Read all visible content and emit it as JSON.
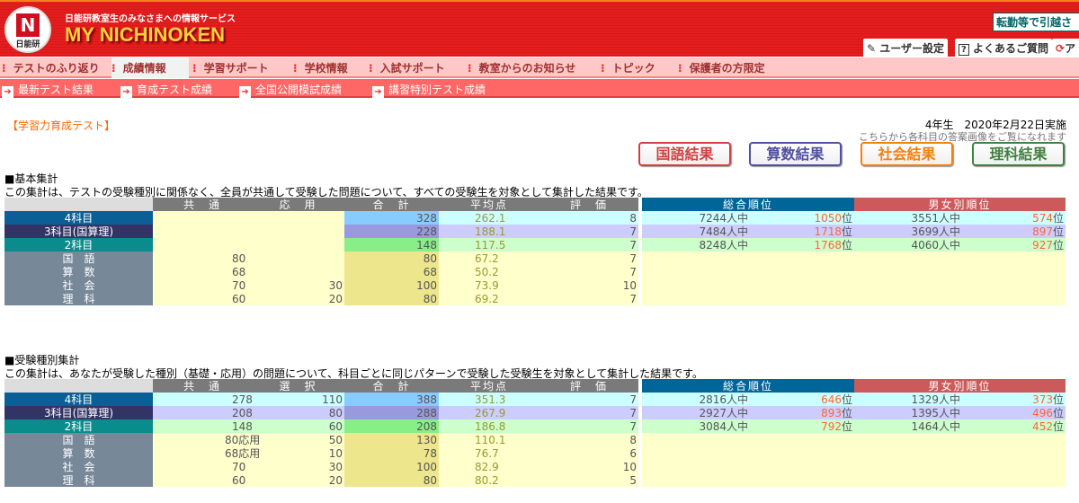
{
  "header": {
    "logo_text": "日能研",
    "subtitle": "日能研教室生のみなさまへの情報サービス",
    "brand": "MY NICHINOKEN",
    "notice": "転勤等で引越さ",
    "user_settings": "ユーザー設定",
    "faq": "よくあるご質問",
    "third_button": "ア"
  },
  "nav": {
    "primary": [
      "テストのふり返り",
      "成績情報",
      "学習サポート",
      "学校情報",
      "入試サポート",
      "教室からのお知らせ",
      "トピック",
      "保護者の方限定"
    ],
    "active": "成績情報",
    "secondary": [
      "最新テスト結果",
      "育成テスト成績",
      "全国公開模試成績",
      "講習特別テスト成績"
    ]
  },
  "page": {
    "title": "【学習力育成テスト】",
    "grade_date": "4年生　2020年2月22日実施",
    "answer_note": "こちらから各科目の答案画像をご覧になれます",
    "buttons": [
      {
        "label": "国語結果",
        "color": "#d04040"
      },
      {
        "label": "算数結果",
        "color": "#5050a0"
      },
      {
        "label": "社会結果",
        "color": "#f08010"
      },
      {
        "label": "理科結果",
        "color": "#408040"
      }
    ]
  },
  "colors": {
    "label_4": "#0a5f96",
    "label_3": "#333366",
    "label_2": "#0a8c8c",
    "label_subject": "#778899",
    "row_4": "#ccffff",
    "total_4": "#88ccff",
    "row_3": "#ccccff",
    "total_3": "#9999dd",
    "row_2": "#ccffcc",
    "total_2": "#88ee88",
    "row_subject": "#ffffcc",
    "total_subject": "#eee68c",
    "rank_overall_header": "#006699",
    "rank_gender_header": "#cc5a5a",
    "rank": "#ff6633"
  },
  "sections": [
    {
      "heading": "■基本集計",
      "description": "この集計は、テストの受験種別に関係なく、全員が共通して受験した問題について、すべての受験生を対象として集計した結果です。",
      "columns": [
        "共　通",
        "応　用",
        "合　計",
        "平均点",
        "評　価"
      ],
      "rank_columns": [
        "総合順位",
        "男女別順位"
      ],
      "rows": [
        {
          "label": "4科目",
          "type": "4",
          "c1": "",
          "c2": "",
          "total": "328",
          "avg": "262.1",
          "grade": "8",
          "overall_of": "7244人中",
          "overall_rank": "1050",
          "gender_of": "3551人中",
          "gender_rank": "574"
        },
        {
          "label": "3科目(国算理)",
          "type": "3",
          "c1": "",
          "c2": "",
          "total": "228",
          "avg": "188.1",
          "grade": "7",
          "overall_of": "7484人中",
          "overall_rank": "1718",
          "gender_of": "3699人中",
          "gender_rank": "897"
        },
        {
          "label": "2科目",
          "type": "2",
          "c1": "",
          "c2": "",
          "total": "148",
          "avg": "117.5",
          "grade": "7",
          "overall_of": "8248人中",
          "overall_rank": "1768",
          "gender_of": "4060人中",
          "gender_rank": "927"
        },
        {
          "label": "国　語",
          "type": "s",
          "c1": "80",
          "c2": "",
          "total": "80",
          "avg": "67.2",
          "grade": "7"
        },
        {
          "label": "算　数",
          "type": "s",
          "c1": "68",
          "c2": "",
          "total": "68",
          "avg": "50.2",
          "grade": "7"
        },
        {
          "label": "社　会",
          "type": "s",
          "c1": "70",
          "c2": "30",
          "total": "100",
          "avg": "73.9",
          "grade": "10"
        },
        {
          "label": "理　科",
          "type": "s",
          "c1": "60",
          "c2": "20",
          "total": "80",
          "avg": "69.2",
          "grade": "7"
        }
      ]
    },
    {
      "heading": "■受験種別集計",
      "description": "この集計は、あなたが受験した種別（基礎・応用）の問題について、科目ごとに同じパターンで受験した受験生を対象として集計した結果です。",
      "columns": [
        "共　通",
        "選　択",
        "合　計",
        "平均点",
        "評　価"
      ],
      "rank_columns": [
        "総合順位",
        "男女別順位"
      ],
      "rows": [
        {
          "label": "4科目",
          "type": "4",
          "c1": "278",
          "c2": "110",
          "total": "388",
          "avg": "351.3",
          "grade": "7",
          "overall_of": "2816人中",
          "overall_rank": "646",
          "gender_of": "1329人中",
          "gender_rank": "373"
        },
        {
          "label": "3科目(国算理)",
          "type": "3",
          "c1": "208",
          "c2": "80",
          "total": "288",
          "avg": "267.9",
          "grade": "7",
          "overall_of": "2927人中",
          "overall_rank": "893",
          "gender_of": "1395人中",
          "gender_rank": "496"
        },
        {
          "label": "2科目",
          "type": "2",
          "c1": "148",
          "c2": "60",
          "total": "208",
          "avg": "186.8",
          "grade": "7",
          "overall_of": "3084人中",
          "overall_rank": "792",
          "gender_of": "1464人中",
          "gender_rank": "452"
        },
        {
          "label": "国　語",
          "type": "s",
          "c1": "80応用",
          "c2": "50",
          "total": "130",
          "avg": "110.1",
          "grade": "8"
        },
        {
          "label": "算　数",
          "type": "s",
          "c1": "68応用",
          "c2": "10",
          "total": "78",
          "avg": "76.7",
          "grade": "6"
        },
        {
          "label": "社　会",
          "type": "s",
          "c1": "70",
          "c2": "30",
          "total": "100",
          "avg": "82.9",
          "grade": "10"
        },
        {
          "label": "理　科",
          "type": "s",
          "c1": "60",
          "c2": "20",
          "total": "80",
          "avg": "80.2",
          "grade": "5"
        }
      ]
    }
  ],
  "rank_suffix": "位"
}
